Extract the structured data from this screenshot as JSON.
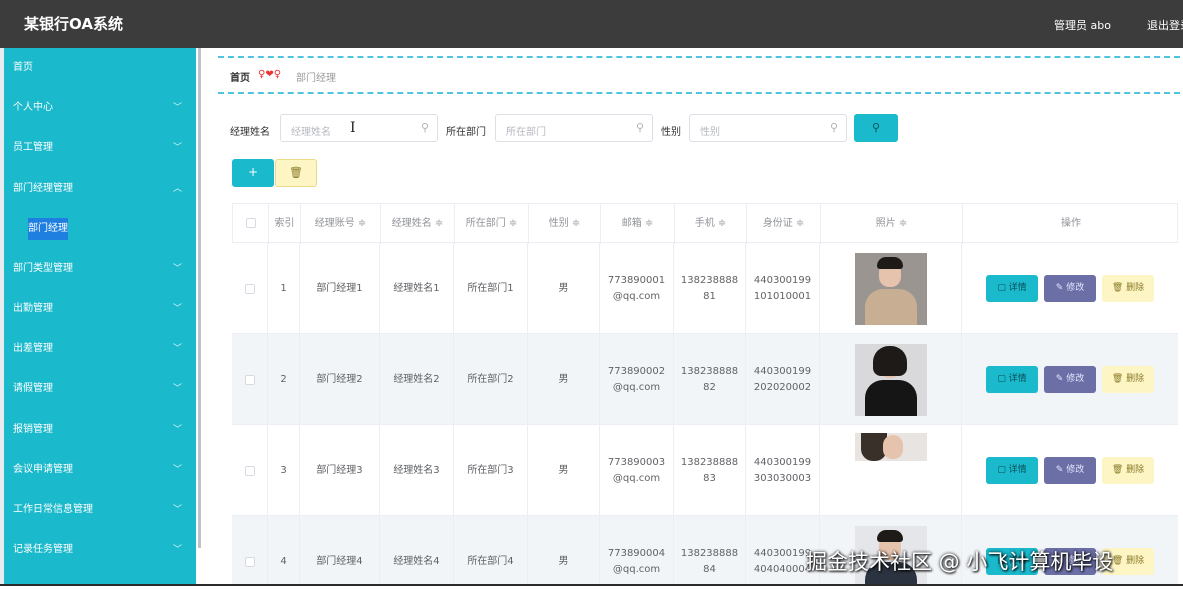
{
  "app": {
    "title": "某银行OA系统",
    "user": "管理员 abo",
    "logout": "退出登录"
  },
  "sidebar": {
    "items": [
      {
        "label": "首页",
        "chevron": ""
      },
      {
        "label": "个人中心",
        "chevron": "﹀"
      },
      {
        "label": "员工管理",
        "chevron": "﹀"
      },
      {
        "label": "部门经理管理",
        "chevron": "︿"
      }
    ],
    "sub_item": "部门经理",
    "items_after": [
      {
        "label": "部门类型管理",
        "chevron": "﹀"
      },
      {
        "label": "出勤管理",
        "chevron": "﹀"
      },
      {
        "label": "出差管理",
        "chevron": "﹀"
      },
      {
        "label": "请假管理",
        "chevron": "﹀"
      },
      {
        "label": "报销管理",
        "chevron": "﹀"
      },
      {
        "label": "会议申请管理",
        "chevron": "﹀"
      },
      {
        "label": "工作日常信息管理",
        "chevron": "﹀"
      },
      {
        "label": "记录任务管理",
        "chevron": "﹀"
      }
    ]
  },
  "breadcrumb": {
    "home": "首页",
    "separator": "♀❤♀",
    "current": "部门经理"
  },
  "search": {
    "name_label": "经理姓名",
    "name_placeholder": "经理姓名",
    "dept_label": "所在部门",
    "dept_placeholder": "所在部门",
    "gender_label": "性别",
    "gender_placeholder": "性别",
    "search_icon": "search-icon"
  },
  "toolbar": {
    "add_label": "+",
    "delete_label": "🗑"
  },
  "table": {
    "headers": {
      "index": "索引",
      "account": "经理账号 ≑",
      "name": "经理姓名 ≑",
      "dept": "所在部门 ≑",
      "gender": "性别 ≑",
      "email": "邮箱 ≑",
      "phone": "手机 ≑",
      "idcard": "身份证 ≑",
      "photo": "照片 ≑",
      "ops": "操作"
    },
    "rows": [
      {
        "index": "1",
        "account": "部门经理1",
        "name": "经理姓名1",
        "dept": "所在部门1",
        "gender": "男",
        "email_1": "773890001",
        "email_2": "@qq.com",
        "phone_1": "138238888",
        "phone_2": "81",
        "idcard_1": "440300199",
        "idcard_2": "101010001"
      },
      {
        "index": "2",
        "account": "部门经理2",
        "name": "经理姓名2",
        "dept": "所在部门2",
        "gender": "男",
        "email_1": "773890002",
        "email_2": "@qq.com",
        "phone_1": "138238888",
        "phone_2": "82",
        "idcard_1": "440300199",
        "idcard_2": "202020002"
      },
      {
        "index": "3",
        "account": "部门经理3",
        "name": "经理姓名3",
        "dept": "所在部门3",
        "gender": "男",
        "email_1": "773890003",
        "email_2": "@qq.com",
        "phone_1": "138238888",
        "phone_2": "83",
        "idcard_1": "440300199",
        "idcard_2": "303030003"
      },
      {
        "index": "4",
        "account": "部门经理4",
        "name": "经理姓名4",
        "dept": "所在部门4",
        "gender": "男",
        "email_1": "773890004",
        "email_2": "@qq.com",
        "phone_1": "138238888",
        "phone_2": "84",
        "idcard_1": "440300199",
        "idcard_2": "404040004"
      }
    ],
    "actions": {
      "detail": "▢ 详情",
      "edit": "✎ 修改",
      "delete": "🗑 删除"
    }
  },
  "watermark": "掘金技术社区 @ 小飞计算机毕设",
  "colors": {
    "sidebar": "#1ab9cc",
    "topbar": "#3c3c3c",
    "edit": "#6b6fa6",
    "delete": "#fdf5c4"
  }
}
